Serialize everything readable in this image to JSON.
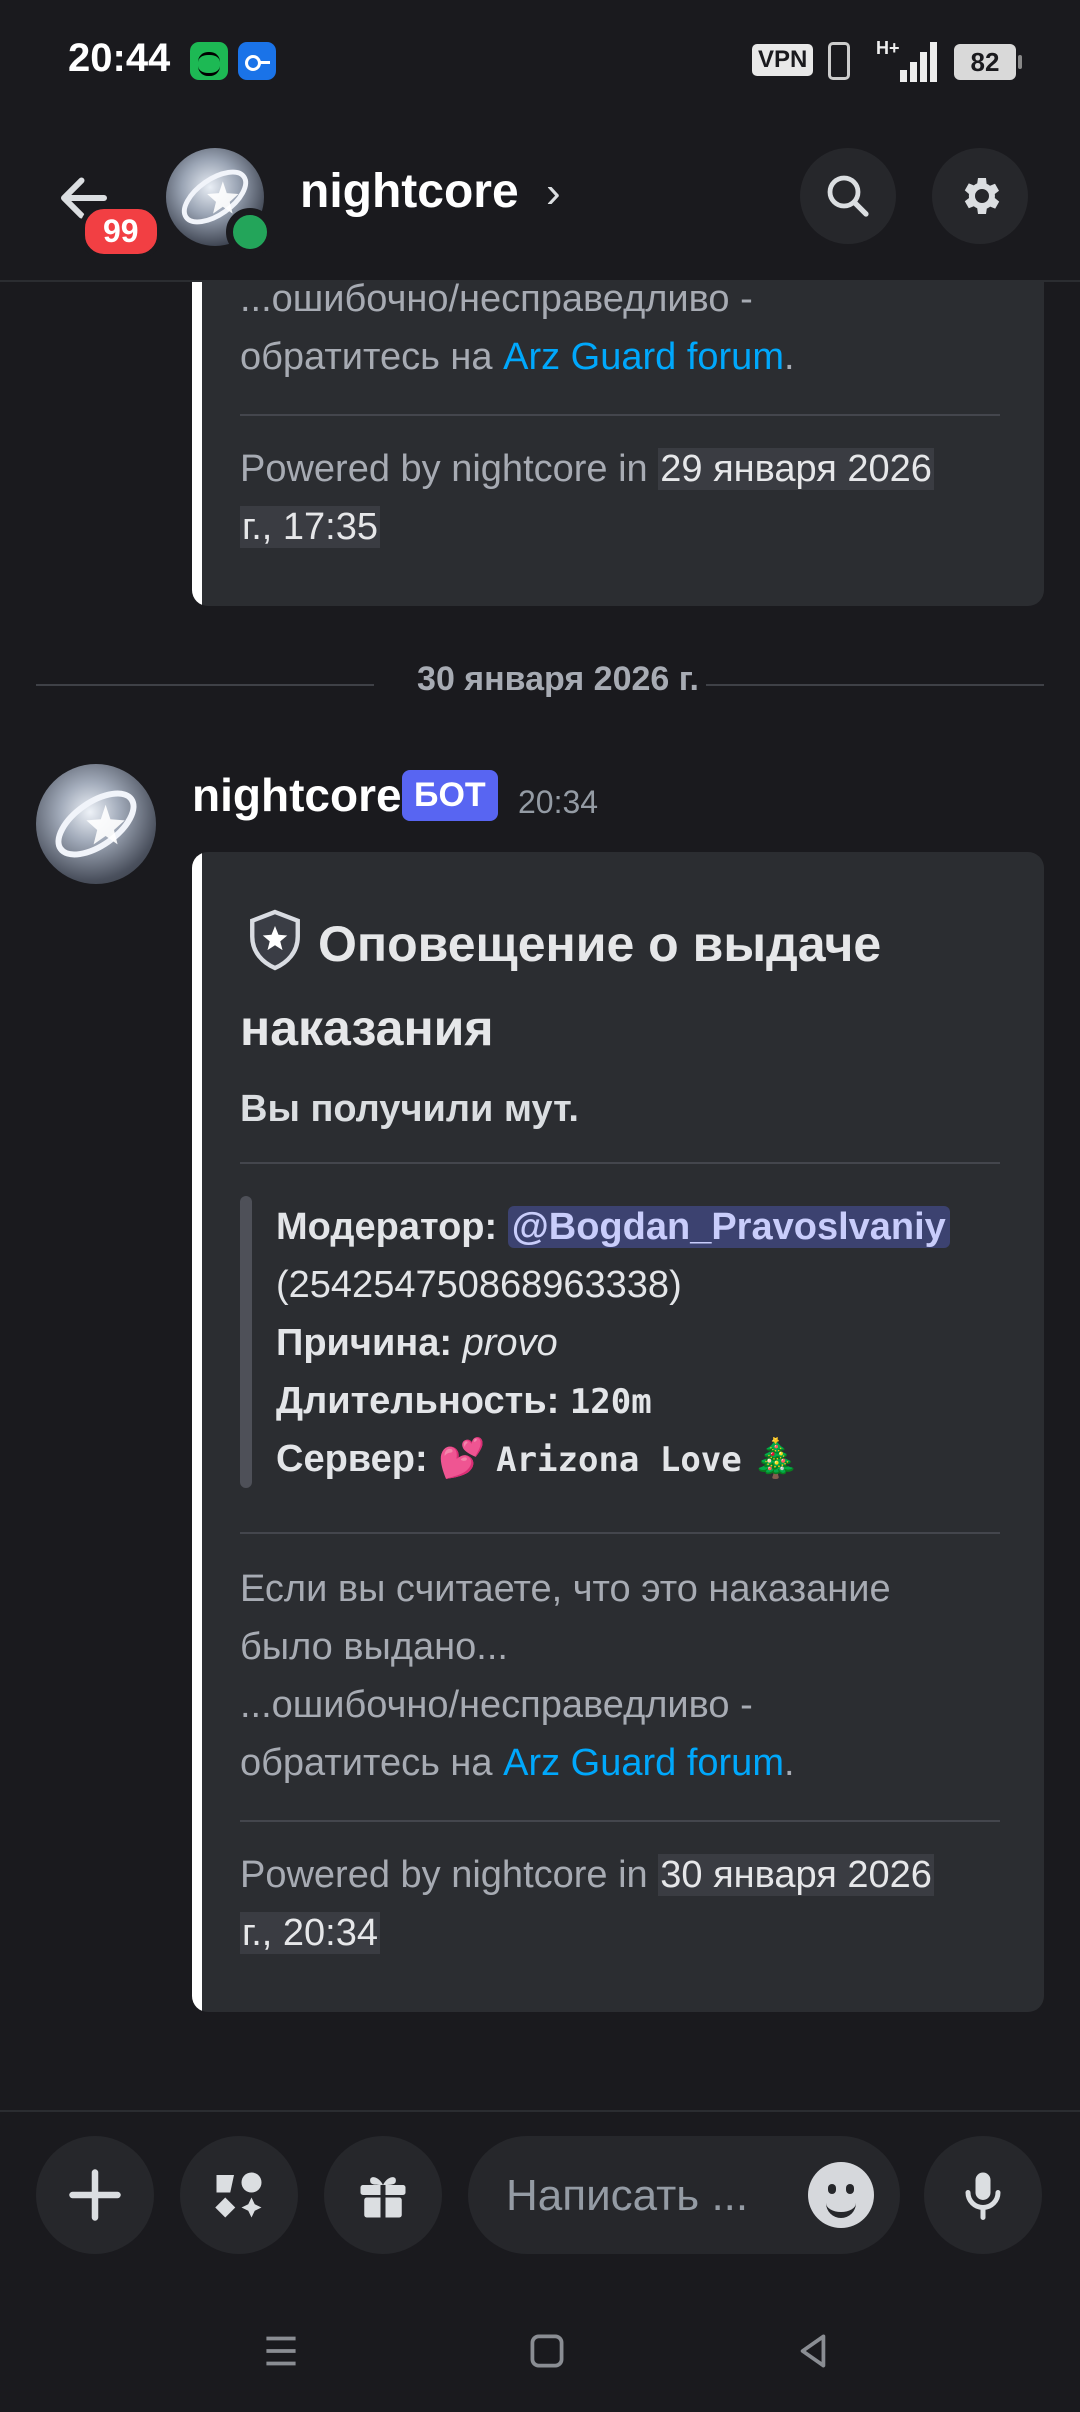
{
  "status_bar": {
    "time": "20:44",
    "vpn": "VPN",
    "network": "H+",
    "battery": "82"
  },
  "header": {
    "unread_count": "99",
    "channel_name": "nightcore",
    "chevron": "›"
  },
  "prev_embed": {
    "line1": "...ошибочно/несправедливо -",
    "line2_prefix": "обратитесь на ",
    "link": "Arz Guard forum",
    "line2_suffix": ".",
    "footer_prefix": "Powered by nightcore in ",
    "footer_ts1": "29 января 2026",
    "footer_ts2": "г., 17:35"
  },
  "date_separator": "30 января 2026 г.",
  "message": {
    "author": "nightcore",
    "bot_tag": "БОТ",
    "time": "20:34",
    "embed": {
      "title_line1": "Оповещение о выдаче",
      "title_line2": "наказания",
      "description": "Вы получили мут.",
      "moderator_label": "Модератор:",
      "moderator_mention": "@Bogdan_Pravoslvaniy",
      "moderator_id": "(254254750868963338)",
      "reason_label": "Причина:",
      "reason_value": "provo",
      "duration_label": "Длительность:",
      "duration_value": "120m",
      "server_label": "Сервер:",
      "server_emoji": "💕",
      "server_value": "Arizona Love",
      "server_tree": "🎄",
      "notice_line1": "Если вы считаете, что это наказание",
      "notice_line2": "было выдано...",
      "notice_line3": "...ошибочно/несправедливо -",
      "notice_line4_prefix": "обратитесь на ",
      "notice_link": "Arz Guard forum",
      "notice_line4_suffix": ".",
      "footer_prefix": "Powered by nightcore in ",
      "footer_ts1": "30 января 2026",
      "footer_ts2": "г., 20:34"
    }
  },
  "input": {
    "placeholder": "Написать ..."
  },
  "icons": {
    "back": "arrow-left-icon",
    "search": "search-icon",
    "settings": "gear-icon",
    "plus": "plus-icon",
    "apps": "apps-icon",
    "gift": "gift-icon",
    "emoji": "emoji-icon",
    "mic": "microphone-icon"
  },
  "colors": {
    "background": "#1a1a1e",
    "embed_bg": "#2b2d31",
    "link": "#00a8fc",
    "bot_tag": "#5865f2",
    "mention_bg": "#3c4270",
    "unread_badge": "#f23f43",
    "online": "#23a55a"
  }
}
